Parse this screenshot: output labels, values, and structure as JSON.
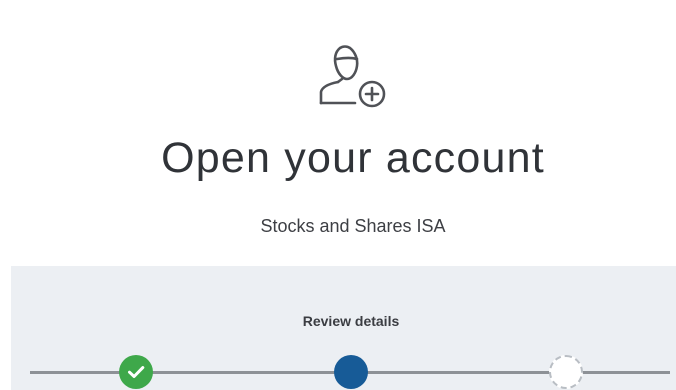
{
  "header": {
    "icon": "user-add-icon",
    "title": "Open your account",
    "subtitle": "Stocks and Shares ISA"
  },
  "stepper": {
    "current_step_label": "Review details",
    "steps": [
      {
        "state": "complete",
        "icon": "check-icon",
        "color": "#3ea84a"
      },
      {
        "state": "current",
        "color": "#175b97"
      },
      {
        "state": "upcoming",
        "color": "#ffffff"
      }
    ]
  },
  "colors": {
    "panel_background": "#eceff3",
    "title_text": "#303338"
  }
}
